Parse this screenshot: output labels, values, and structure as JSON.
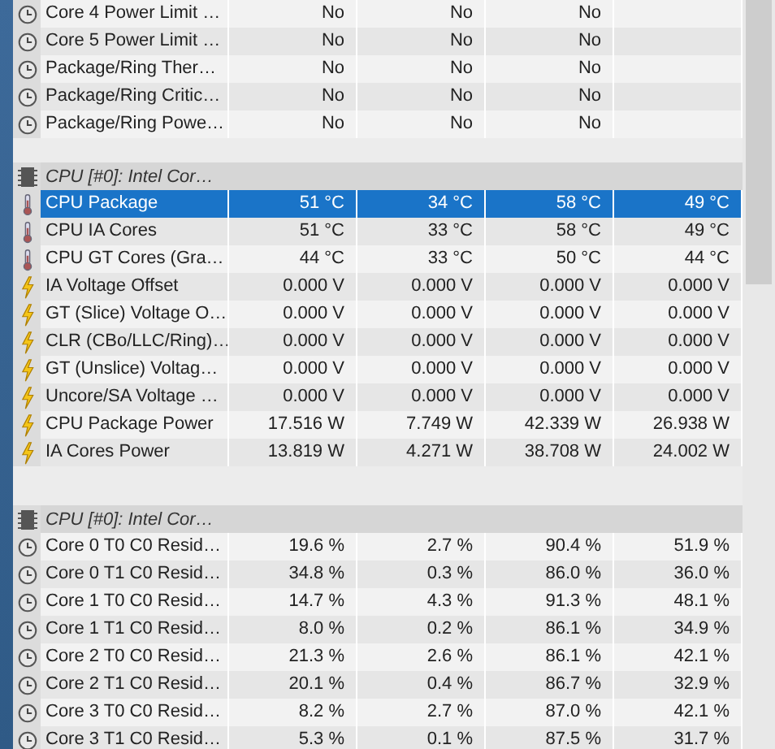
{
  "groups": [
    {
      "rows": [
        {
          "kind": "clock",
          "name": "Core 4 Power Limit …",
          "values": [
            "No",
            "No",
            "No"
          ],
          "selected": false
        },
        {
          "kind": "clock",
          "name": "Core 5 Power Limit …",
          "values": [
            "No",
            "No",
            "No"
          ],
          "selected": false
        },
        {
          "kind": "clock",
          "name": "Package/Ring Ther…",
          "values": [
            "No",
            "No",
            "No"
          ],
          "selected": false
        },
        {
          "kind": "clock",
          "name": "Package/Ring Critic…",
          "values": [
            "No",
            "No",
            "No"
          ],
          "selected": false
        },
        {
          "kind": "clock",
          "name": "Package/Ring Powe…",
          "values": [
            "No",
            "No",
            "No"
          ],
          "selected": false
        }
      ]
    },
    {
      "header": "CPU [#0]: Intel Cor…",
      "rows": [
        {
          "kind": "temp",
          "name": "CPU Package",
          "values": [
            "51 °C",
            "34 °C",
            "58 °C",
            "49 °C"
          ],
          "selected": true
        },
        {
          "kind": "temp",
          "name": "CPU IA Cores",
          "values": [
            "51 °C",
            "33 °C",
            "58 °C",
            "49 °C"
          ],
          "selected": false
        },
        {
          "kind": "temp",
          "name": "CPU GT Cores (Gra…",
          "values": [
            "44 °C",
            "33 °C",
            "50 °C",
            "44 °C"
          ],
          "selected": false
        },
        {
          "kind": "bolt",
          "name": "IA Voltage Offset",
          "values": [
            "0.000 V",
            "0.000 V",
            "0.000 V",
            "0.000 V"
          ],
          "selected": false
        },
        {
          "kind": "bolt",
          "name": "GT (Slice) Voltage O…",
          "values": [
            "0.000 V",
            "0.000 V",
            "0.000 V",
            "0.000 V"
          ],
          "selected": false
        },
        {
          "kind": "bolt",
          "name": "CLR (CBo/LLC/Ring)…",
          "values": [
            "0.000 V",
            "0.000 V",
            "0.000 V",
            "0.000 V"
          ],
          "selected": false
        },
        {
          "kind": "bolt",
          "name": "GT (Unslice) Voltag…",
          "values": [
            "0.000 V",
            "0.000 V",
            "0.000 V",
            "0.000 V"
          ],
          "selected": false
        },
        {
          "kind": "bolt",
          "name": "Uncore/SA Voltage …",
          "values": [
            "0.000 V",
            "0.000 V",
            "0.000 V",
            "0.000 V"
          ],
          "selected": false
        },
        {
          "kind": "bolt",
          "name": "CPU Package Power",
          "values": [
            "17.516 W",
            "7.749 W",
            "42.339 W",
            "26.938 W"
          ],
          "selected": false
        },
        {
          "kind": "bolt",
          "name": "IA Cores Power",
          "values": [
            "13.819 W",
            "4.271 W",
            "38.708 W",
            "24.002 W"
          ],
          "selected": false
        }
      ]
    },
    {
      "header": "CPU [#0]: Intel Cor…",
      "rows": [
        {
          "kind": "clock",
          "name": "Core 0 T0 C0 Resid…",
          "values": [
            "19.6 %",
            "2.7 %",
            "90.4 %",
            "51.9 %"
          ],
          "selected": false
        },
        {
          "kind": "clock",
          "name": "Core 0 T1 C0 Resid…",
          "values": [
            "34.8 %",
            "0.3 %",
            "86.0 %",
            "36.0 %"
          ],
          "selected": false
        },
        {
          "kind": "clock",
          "name": "Core 1 T0 C0 Resid…",
          "values": [
            "14.7 %",
            "4.3 %",
            "91.3 %",
            "48.1 %"
          ],
          "selected": false
        },
        {
          "kind": "clock",
          "name": "Core 1 T1 C0 Resid…",
          "values": [
            "8.0 %",
            "0.2 %",
            "86.1 %",
            "34.9 %"
          ],
          "selected": false
        },
        {
          "kind": "clock",
          "name": "Core 2 T0 C0 Resid…",
          "values": [
            "21.3 %",
            "2.6 %",
            "86.1 %",
            "42.1 %"
          ],
          "selected": false
        },
        {
          "kind": "clock",
          "name": "Core 2 T1 C0 Resid…",
          "values": [
            "20.1 %",
            "0.4 %",
            "86.7 %",
            "32.9 %"
          ],
          "selected": false
        },
        {
          "kind": "clock",
          "name": "Core 3 T0 C0 Resid…",
          "values": [
            "8.2 %",
            "2.7 %",
            "87.0 %",
            "42.1 %"
          ],
          "selected": false
        },
        {
          "kind": "clock",
          "name": "Core 3 T1 C0 Resid…",
          "values": [
            "5.3 %",
            "0.1 %",
            "87.5 %",
            "31.7 %"
          ],
          "selected": false
        }
      ]
    }
  ]
}
